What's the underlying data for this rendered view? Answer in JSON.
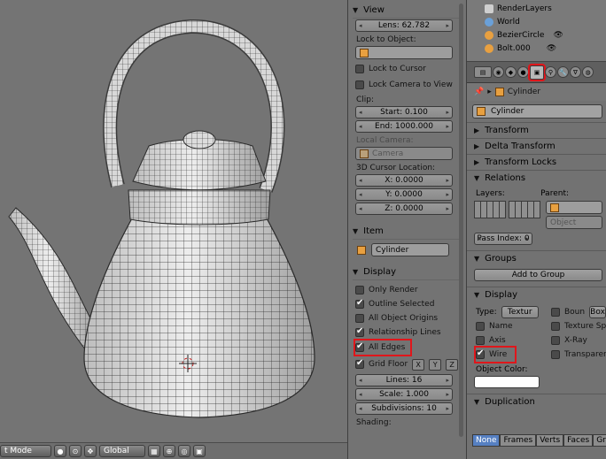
{
  "viewport": {
    "mode_label": "t Mode",
    "orientation_label": "Global"
  },
  "view_panel": {
    "title": "View",
    "lens": "Lens: 62.782",
    "lock_to_object_label": "Lock to Object:",
    "lock_to_cursor": "Lock to Cursor",
    "lock_camera_to_view": "Lock Camera to View",
    "clip_label": "Clip:",
    "clip_start": "Start: 0.100",
    "clip_end": "End: 1000.000",
    "local_camera_label": "Local Camera:",
    "camera_value": "Camera",
    "cursor_label": "3D Cursor Location:",
    "cursor_x": "X: 0.0000",
    "cursor_y": "Y: 0.0000",
    "cursor_z": "Z: 0.0000"
  },
  "item_panel": {
    "title": "Item",
    "name": "Cylinder"
  },
  "display_panel": {
    "title": "Display",
    "only_render": "Only Render",
    "outline_selected": "Outline Selected",
    "all_object_origins": "All Object Origins",
    "relationship_lines": "Relationship Lines",
    "all_edges": "All Edges",
    "grid_floor": "Grid Floor",
    "axis_x": "X",
    "axis_y": "Y",
    "axis_z": "Z",
    "lines": "Lines: 16",
    "scale": "Scale: 1.000",
    "subdivisions": "Subdivisions: 10",
    "shading_label": "Shading:"
  },
  "outliner": {
    "items": [
      "RenderLayers",
      "World",
      "BezierCircle",
      "Bolt.000"
    ]
  },
  "properties": {
    "breadcrumb": "Cylinder",
    "object_name": "Cylinder",
    "sections": {
      "transform": "Transform",
      "delta_transform": "Delta Transform",
      "transform_locks": "Transform Locks",
      "relations": "Relations",
      "groups": "Groups",
      "display": "Display",
      "duplication": "Duplication"
    },
    "layers_label": "Layers:",
    "parent_label": "Parent:",
    "parent_type": "Object",
    "pass_index": "Pass Index: 0",
    "add_to_group": "Add to Group",
    "type_label": "Type:",
    "type_value": "Textur",
    "name_cb": "Name",
    "axis_cb": "Axis",
    "wire_cb": "Wire",
    "bounds_cb": "Boun",
    "box_label": "Box",
    "texture_space_cb": "Texture Spac",
    "xray_cb": "X-Ray",
    "transparency_cb": "Transparenc",
    "object_color_label": "Object Color:",
    "dup_tabs": [
      "None",
      "Frames",
      "Verts",
      "Faces",
      "Gro"
    ]
  }
}
